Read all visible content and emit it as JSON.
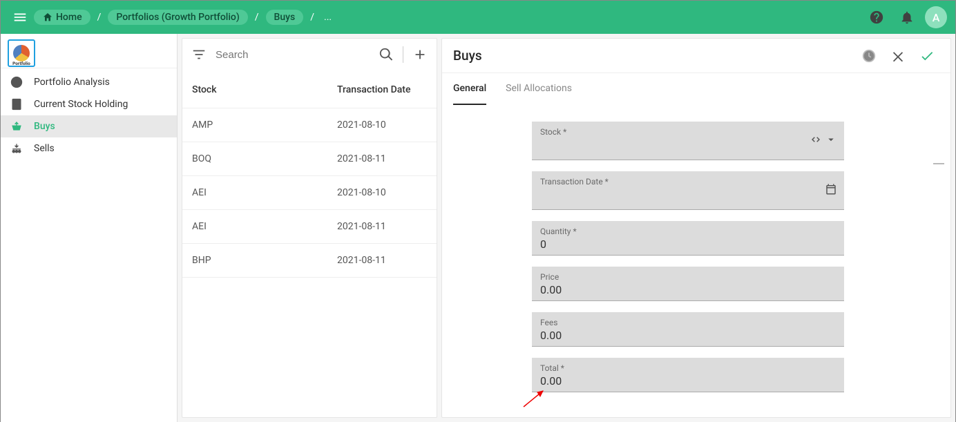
{
  "header": {
    "breadcrumb": {
      "home": "Home",
      "portfolios": "Portfolios (Growth Portfolio)",
      "buys": "Buys",
      "ellipsis": "..."
    },
    "avatar_initial": "A"
  },
  "sidebar": {
    "logo_text": "Portfolio",
    "items": [
      {
        "label": "Portfolio Analysis"
      },
      {
        "label": "Current Stock Holding"
      },
      {
        "label": "Buys"
      },
      {
        "label": "Sells"
      }
    ]
  },
  "list": {
    "search_placeholder": "Search",
    "columns": {
      "stock": "Stock",
      "date": "Transaction Date"
    },
    "rows": [
      {
        "stock": "AMP",
        "date": "2021-08-10"
      },
      {
        "stock": "BOQ",
        "date": "2021-08-11"
      },
      {
        "stock": "AEI",
        "date": "2021-08-10"
      },
      {
        "stock": "AEI",
        "date": "2021-08-11"
      },
      {
        "stock": "BHP",
        "date": "2021-08-11"
      }
    ]
  },
  "detail": {
    "title": "Buys",
    "tabs": {
      "general": "General",
      "sell": "Sell Allocations"
    },
    "form": {
      "stock_label": "Stock *",
      "date_label": "Transaction Date *",
      "quantity_label": "Quantity *",
      "quantity_value": "0",
      "price_label": "Price",
      "price_value": "0.00",
      "fees_label": "Fees",
      "fees_value": "0.00",
      "total_label": "Total *",
      "total_value": "0.00"
    }
  }
}
